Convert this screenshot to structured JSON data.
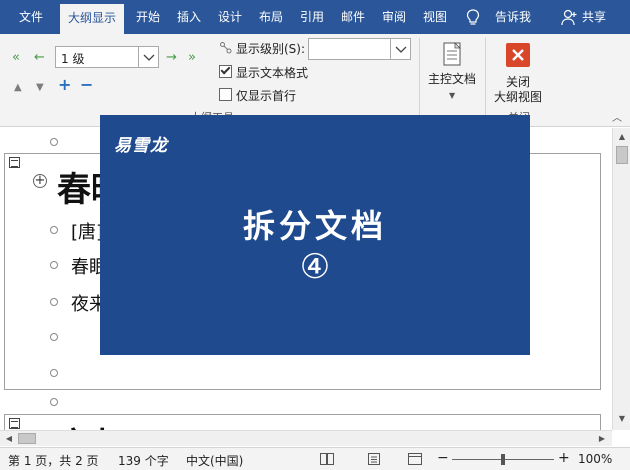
{
  "tabs": [
    {
      "label": "文件",
      "active": false
    },
    {
      "label": "大纲显示",
      "active": true
    },
    {
      "label": "开始",
      "active": false
    },
    {
      "label": "插入",
      "active": false
    },
    {
      "label": "设计",
      "active": false
    },
    {
      "label": "布局",
      "active": false
    },
    {
      "label": "引用",
      "active": false
    },
    {
      "label": "邮件",
      "active": false
    },
    {
      "label": "审阅",
      "active": false
    },
    {
      "label": "视图",
      "active": false
    }
  ],
  "tell_me": "告诉我",
  "share": "共享",
  "ribbon": {
    "level_select_value": "1 级",
    "show_level_label": "显示级别(S):",
    "show_text_format_label": "显示文本格式",
    "show_text_format_checked": true,
    "show_first_line_label": "仅显示首行",
    "show_first_line_checked": false,
    "outline_tools_group": "大纲工具",
    "master_doc_label": "主控文档",
    "close_group": "关闭",
    "close_label_line1": "关闭",
    "close_label_line2": "大纲视图",
    "colors": {
      "accent": "#2b579a",
      "close_red": "#d9472b",
      "arrow_green": "#4a9a4a"
    }
  },
  "document": {
    "heading1": "春晓",
    "lines": [
      "[唐]",
      "春眠",
      "夜来"
    ],
    "heading2": "夜归"
  },
  "banner": {
    "logo": "易雪龙",
    "title": "拆分文档",
    "number": "④",
    "color": "#1f4a8e"
  },
  "statusbar": {
    "page": "第 1 页，共 2 页",
    "words": "139 个字",
    "language": "中文(中国)",
    "zoom_out": "−",
    "zoom_in": "+",
    "zoom": "100%",
    "zoom_level_fraction": 0.5
  }
}
